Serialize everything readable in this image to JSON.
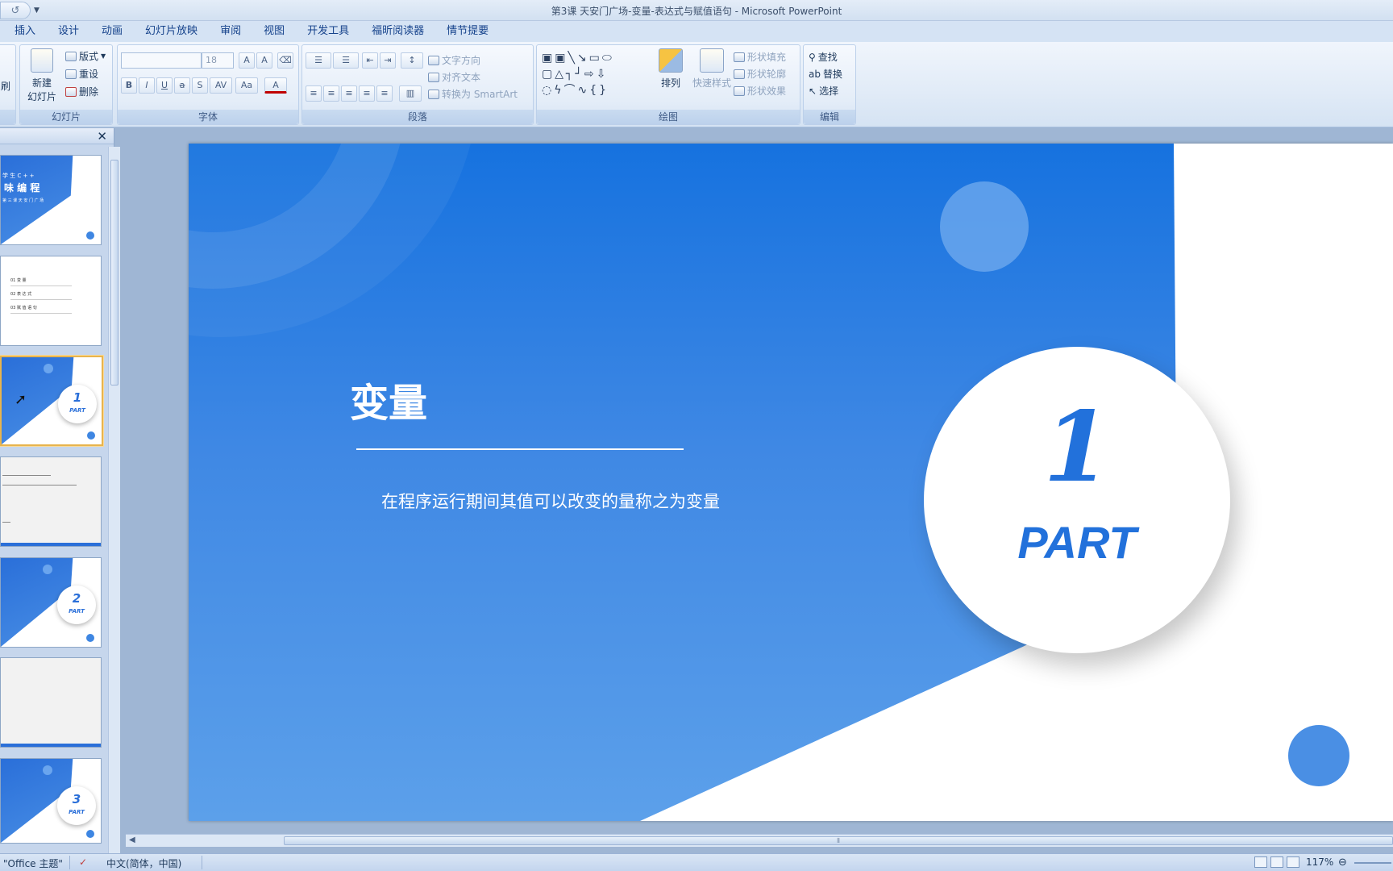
{
  "window": {
    "title": "第3课 天安门广场-变量-表达式与赋值语句 - Microsoft PowerPoint"
  },
  "tabs": [
    "插入",
    "设计",
    "动画",
    "幻灯片放映",
    "审阅",
    "视图",
    "开发工具",
    "福昕阅读器",
    "情节提要"
  ],
  "ribbon": {
    "slides_group": {
      "label": "幻灯片",
      "new_slide": "新建",
      "new_slide_sub": "幻灯片",
      "layout": "版式",
      "reset": "重设",
      "delete": "删除",
      "partial_left": "刷"
    },
    "font_group": {
      "label": "字体",
      "font_size": "18"
    },
    "paragraph_group": {
      "label": "段落",
      "text_direction": "文字方向",
      "align_text": "对齐文本",
      "convert_smartart": "转换为 SmartArt"
    },
    "drawing_group": {
      "label": "绘图",
      "arrange": "排列",
      "quick_styles": "快速样式",
      "shape_fill": "形状填充",
      "shape_outline": "形状轮廓",
      "shape_effects": "形状效果"
    },
    "editing_group": {
      "label": "编辑",
      "find": "查找",
      "replace": "替换",
      "select": "选择"
    }
  },
  "thumbnails": {
    "t1": {
      "title_small": "学 生 C + +",
      "title": "味 编 程",
      "sub": "第 三 课 天 安 门 广 场"
    },
    "t2": {
      "item1": "01  变 量",
      "item2": "02  表 达 式",
      "item3": "03  赋 值 语 句"
    },
    "t3": {
      "num": "1",
      "part": "PART"
    },
    "t5": {
      "num": "2",
      "part": "PART"
    },
    "t7": {
      "num": "3",
      "part": "PART"
    }
  },
  "slide": {
    "heading": "变量",
    "subtitle": "在程序运行期间其值可以改变的量称之为变量",
    "circle_number": "1",
    "circle_label": "PART"
  },
  "statusbar": {
    "theme": "\"Office 主题\"",
    "language": "中文(简体，中国)",
    "zoom": "117%"
  },
  "colors": {
    "slide_blue_top": "#1672df",
    "slide_blue_bottom": "#5ca0ea",
    "part_text": "#2271db",
    "selection_border": "#e8b44d"
  }
}
